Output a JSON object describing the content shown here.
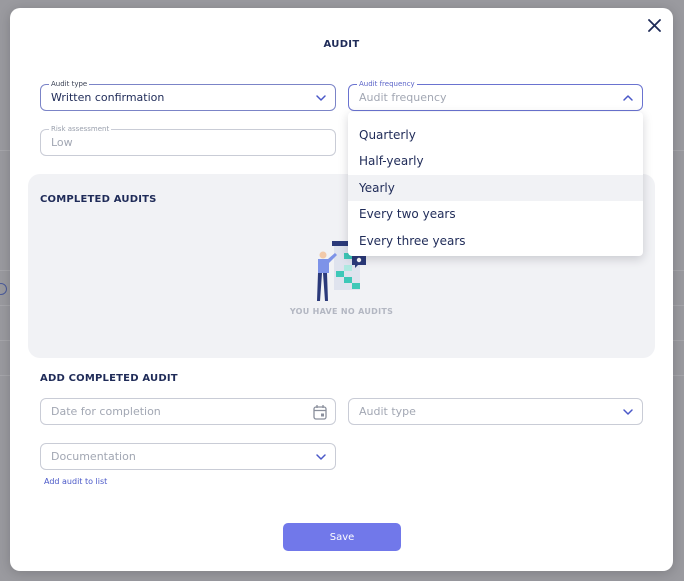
{
  "modal": {
    "title": "AUDIT",
    "close_icon": "close-icon"
  },
  "audit_type": {
    "label": "Audit type",
    "value": "Written confirmation"
  },
  "audit_frequency": {
    "label": "Audit frequency",
    "placeholder": "Audit frequency",
    "options": [
      "Quarterly",
      "Half-yearly",
      "Yearly",
      "Every two years",
      "Every three years"
    ],
    "highlighted": "Yearly"
  },
  "risk_assessment": {
    "label": "Risk assessment",
    "value": "Low"
  },
  "completed_audits": {
    "title": "COMPLETED AUDITS",
    "empty_text": "YOU HAVE NO AUDITS"
  },
  "add_completed_audit": {
    "title": "ADD COMPLETED AUDIT",
    "date_placeholder": "Date for completion",
    "type_placeholder": "Audit type",
    "documentation_placeholder": "Documentation",
    "add_link": "Add audit to list"
  },
  "save_label": "Save",
  "colors": {
    "accent": "#7178ea",
    "title": "#1f2b58",
    "link": "#4a58c8",
    "panel_bg": "#f1f2f5"
  }
}
